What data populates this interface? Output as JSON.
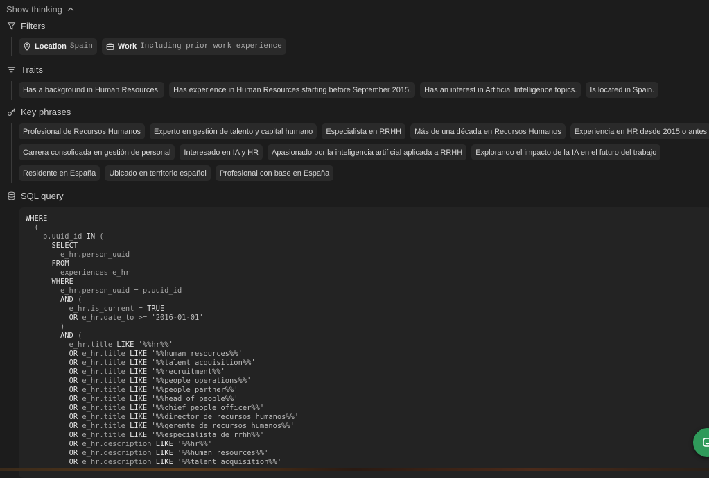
{
  "show_thinking": {
    "label": "Show thinking"
  },
  "filters": {
    "title": "Filters",
    "items": [
      {
        "key": "Location",
        "value": "Spain",
        "icon": "map-pin-icon"
      },
      {
        "key": "Work",
        "value": "Including prior work experience",
        "icon": "briefcase-icon"
      }
    ]
  },
  "traits": {
    "title": "Traits",
    "items": [
      "Has a background in Human Resources.",
      "Has experience in Human Resources starting before September 2015.",
      "Has an interest in Artificial Intelligence topics.",
      "Is located in Spain."
    ]
  },
  "key_phrases": {
    "title": "Key phrases",
    "rows": [
      [
        "Profesional de Recursos Humanos",
        "Experto en gestión de talento y capital humano",
        "Especialista en RRHH",
        "Más de una década en Recursos Humanos",
        "Experiencia en HR desde 2015 o antes"
      ],
      [
        "Carrera consolidada en gestión de personal",
        "Interesado en IA y HR",
        "Apasionado por la inteligencia artificial aplicada a RRHH",
        "Explorando el impacto de la IA en el futuro del trabajo"
      ],
      [
        "Residente en España",
        "Ubicado en territorio español",
        "Profesional con base en España"
      ]
    ]
  },
  "sql": {
    "title": "SQL query",
    "lines": [
      "WHERE",
      "  (",
      "    p.uuid_id IN (",
      "      SELECT",
      "        e_hr.person_uuid",
      "      FROM",
      "        experiences e_hr",
      "      WHERE",
      "        e_hr.person_uuid = p.uuid_id",
      "        AND (",
      "          e_hr.is_current = TRUE",
      "          OR e_hr.date_to >= '2016-01-01'",
      "        )",
      "        AND (",
      "          e_hr.title LIKE '%%hr%%'",
      "          OR e_hr.title LIKE '%%human resources%%'",
      "          OR e_hr.title LIKE '%%talent acquisition%%'",
      "          OR e_hr.title LIKE '%%recruitment%%'",
      "          OR e_hr.title LIKE '%%people operations%%'",
      "          OR e_hr.title LIKE '%%people partner%%'",
      "          OR e_hr.title LIKE '%%head of people%%'",
      "          OR e_hr.title LIKE '%%chief people officer%%'",
      "          OR e_hr.title LIKE '%%director de recursos humanos%%'",
      "          OR e_hr.title LIKE '%%gerente de recursos humanos%%'",
      "          OR e_hr.title LIKE '%%especialista de rrhh%%'",
      "          OR e_hr.description LIKE '%%hr%%'",
      "          OR e_hr.description LIKE '%%human resources%%'",
      "          OR e_hr.description LIKE '%%talent acquisition%%'"
    ]
  },
  "colors": {
    "background": "#1c1c1c",
    "chip": "#2a2a2a",
    "code_bg": "#232323",
    "chat_button": "#2f9a5a"
  }
}
